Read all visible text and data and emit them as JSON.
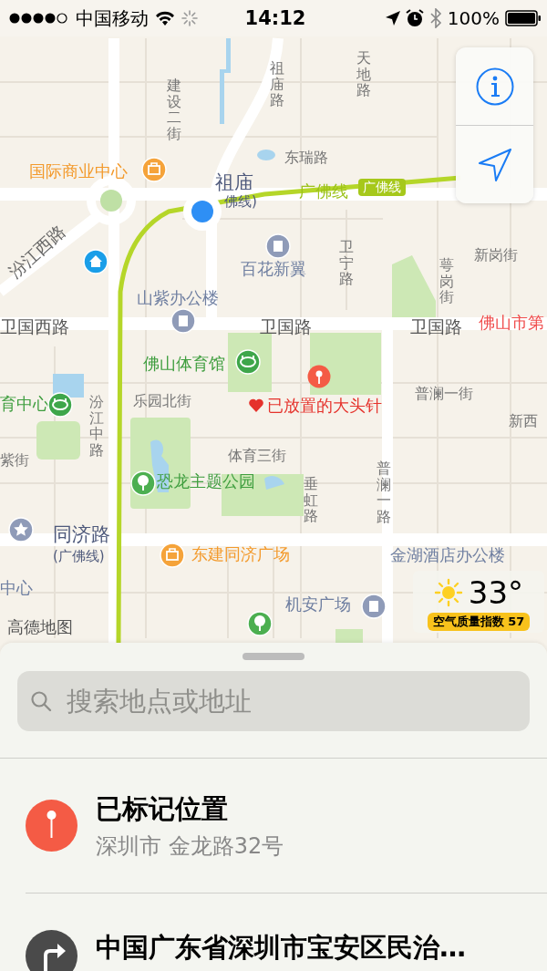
{
  "status_bar": {
    "carrier": "中国移动",
    "time": "14:12",
    "battery": "100%"
  },
  "map": {
    "labels": [
      {
        "text": "建设二街",
        "kind": "road-vertical"
      },
      {
        "text": "祖庙路",
        "kind": "road-vertical"
      },
      {
        "text": "天地路",
        "kind": "road-vertical"
      },
      {
        "text": "东瑞路",
        "kind": "road"
      },
      {
        "text": "国际商业中心",
        "kind": "poi-shop"
      },
      {
        "text": "祖庙",
        "kind": "station"
      },
      {
        "text": "佛线)",
        "kind": "station-line"
      },
      {
        "text": "广佛线",
        "kind": "transit-line"
      },
      {
        "text": "广佛线",
        "kind": "transit-badge"
      },
      {
        "text": "汾江西路",
        "kind": "road-diagonal"
      },
      {
        "text": "百花新翼",
        "kind": "poi-building"
      },
      {
        "text": "卫宁路",
        "kind": "road-vertical"
      },
      {
        "text": "萼岗街",
        "kind": "road-vertical"
      },
      {
        "text": "新岗街",
        "kind": "road"
      },
      {
        "text": "山紫办公楼",
        "kind": "poi-building"
      },
      {
        "text": "卫国西路",
        "kind": "road-major"
      },
      {
        "text": "卫国路",
        "kind": "road-major"
      },
      {
        "text": "卫国路",
        "kind": "road-major"
      },
      {
        "text": "佛山市第",
        "kind": "district"
      },
      {
        "text": "佛山体育馆",
        "kind": "poi-park"
      },
      {
        "text": "育中心",
        "kind": "poi-park"
      },
      {
        "text": "汾江中路",
        "kind": "road-vertical"
      },
      {
        "text": "乐园北街",
        "kind": "road"
      },
      {
        "text": "已放置的大头针",
        "kind": "dropped-pin"
      },
      {
        "text": "普澜一街",
        "kind": "road"
      },
      {
        "text": "新西",
        "kind": "road"
      },
      {
        "text": "紫街",
        "kind": "road"
      },
      {
        "text": "体育三街",
        "kind": "road"
      },
      {
        "text": "恐龙主题公园",
        "kind": "poi-park"
      },
      {
        "text": "垂虹路",
        "kind": "road-vertical"
      },
      {
        "text": "普澜一路",
        "kind": "road-vertical"
      },
      {
        "text": "同济路",
        "kind": "station"
      },
      {
        "text": "(广佛线)",
        "kind": "station-line"
      },
      {
        "text": "东建同济广场",
        "kind": "poi-shop"
      },
      {
        "text": "金湖酒店办公楼",
        "kind": "poi-building"
      },
      {
        "text": "中心",
        "kind": "poi-building"
      },
      {
        "text": "机安广场",
        "kind": "poi-building"
      },
      {
        "text": "高德地图",
        "kind": "attribution"
      }
    ],
    "weather": {
      "temperature": "33°",
      "air_quality": "空气质量指数 57"
    }
  },
  "search": {
    "placeholder": "搜索地点或地址"
  },
  "results": [
    {
      "kind": "pin",
      "title": "已标记位置",
      "subtitle": "深圳市 金龙路32号"
    },
    {
      "kind": "directions",
      "title": "中国广东省深圳市宝安区民治…"
    }
  ]
}
